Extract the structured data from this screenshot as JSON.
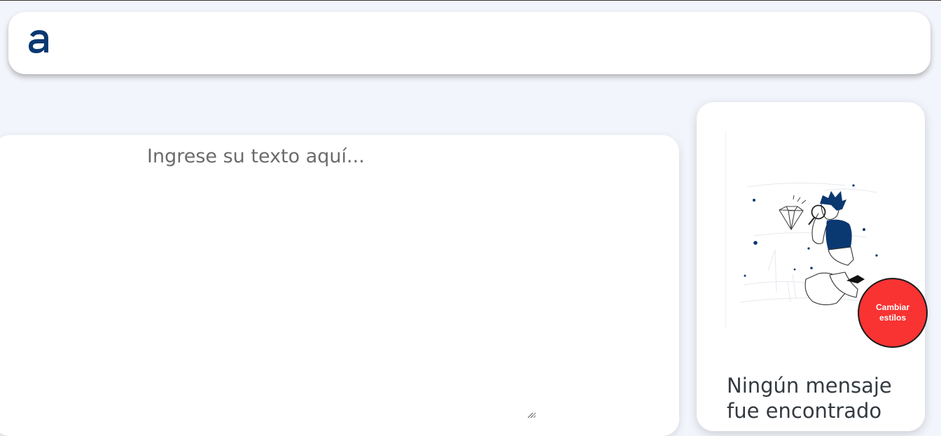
{
  "header": {
    "logo_icon": "alura-a-logo"
  },
  "editor": {
    "placeholder": "Ingrese su texto aquí..."
  },
  "result": {
    "illustration_icon": "person-searching-diamond-illustration",
    "empty_title": "Ningún mensaje fue encontrado"
  },
  "style_button": {
    "label": "Cambiar estilos"
  },
  "colors": {
    "brand": "#0a3871",
    "accent_button": "#f93232",
    "background": "#f3f5fc"
  }
}
